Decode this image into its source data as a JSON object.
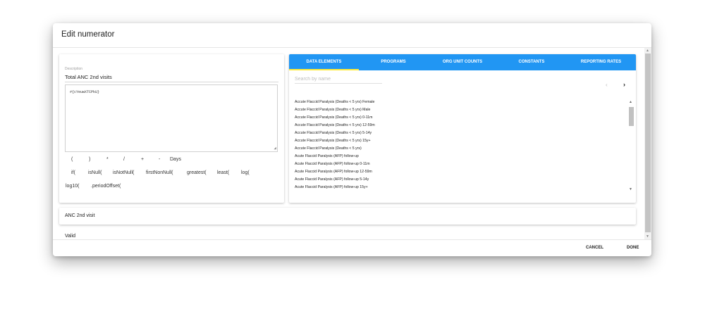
{
  "dialog": {
    "title": "Edit numerator",
    "cancel_label": "CANCEL",
    "done_label": "DONE"
  },
  "editor": {
    "description_label": "Description",
    "description_value": "Total ANC 2nd visits",
    "expression": "#{cYeuwXTCPkU}",
    "operators": [
      "(",
      ")",
      "*",
      "/",
      "+",
      "-",
      "Days"
    ],
    "functions_row1": [
      "if(",
      "isNull(",
      "isNotNull(",
      "firstNonNull(",
      "greatest(",
      "least(",
      "log("
    ],
    "functions_row2": [
      "log10(",
      ".periodOffset("
    ]
  },
  "picker": {
    "tabs": [
      "DATA ELEMENTS",
      "PROGRAMS",
      "ORG UNIT COUNTS",
      "CONSTANTS",
      "REPORTING RATES"
    ],
    "active_tab_index": 0,
    "search_placeholder": "Search by name",
    "pager_prev": "‹",
    "pager_next": "›",
    "items": [
      "Accute Flaccid Paralysis (Deaths < 5 yrs) Female",
      "Accute Flaccid Paralysis (Deaths < 5 yrs) Male",
      "Accute Flaccid Paralysis (Deaths < 5 yrs) 0-11m",
      "Accute Flaccid Paralysis (Deaths < 5 yrs) 12-59m",
      "Accute Flaccid Paralysis (Deaths < 5 yrs) 5-14y",
      "Accute Flaccid Paralysis (Deaths < 5 yrs) 15y+",
      "Accute Flaccid Paralysis (Deaths < 5 yrs)",
      "Acute Flaccid Paralysis (AFP) follow-up",
      "Acute Flaccid Paralysis (AFP) follow-up 0-11m",
      "Acute Flaccid Paralysis (AFP) follow-up 12-59m",
      "Acute Flaccid Paralysis (AFP) follow-up 5-14y",
      "Acute Flaccid Paralysis (AFP) follow-up 15y+"
    ]
  },
  "expression_description": "ANC 2nd visit",
  "validation_status": "Valid",
  "colors": {
    "tab_bar": "#2196f3",
    "tab_indicator": "#ffeb3b"
  }
}
